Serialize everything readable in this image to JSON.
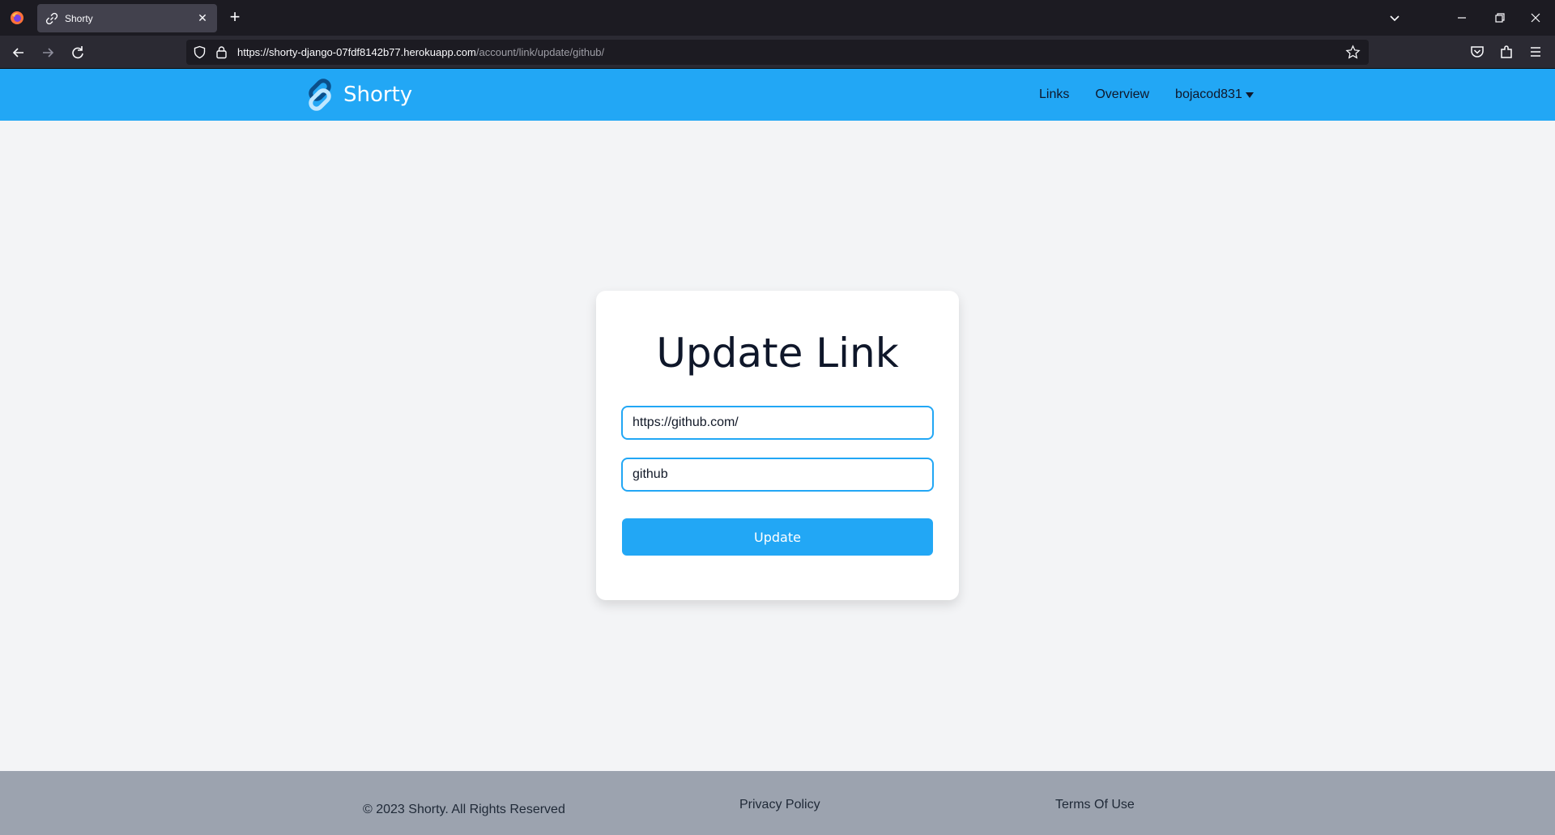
{
  "browser": {
    "tab_title": "Shorty",
    "url_host": "https://shorty-django-07fdf8142b77.herokuapp.com",
    "url_path": "/account/link/update/github/"
  },
  "header": {
    "brand": "Shorty",
    "nav": {
      "links": "Links",
      "overview": "Overview"
    },
    "user": "bojacod831",
    "colors": {
      "bar": "#22a7f5"
    }
  },
  "form": {
    "title": "Update Link",
    "url_value": "https://github.com/",
    "slug_value": "github",
    "submit_label": "Update"
  },
  "footer": {
    "copyright": "© 2023 Shorty. All Rights Reserved",
    "privacy": "Privacy Policy",
    "terms": "Terms Of Use"
  }
}
